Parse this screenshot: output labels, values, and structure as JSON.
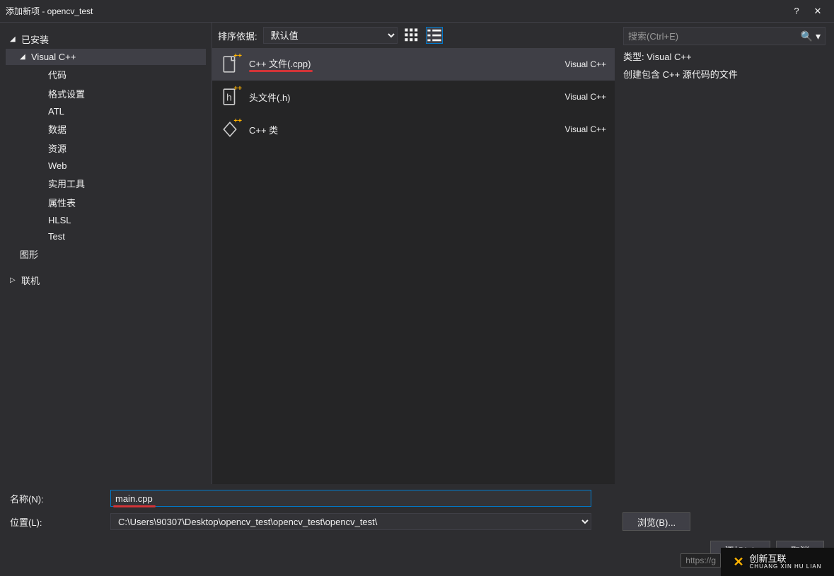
{
  "window": {
    "title": "添加新项 - opencv_test",
    "help": "?",
    "close": "✕"
  },
  "sidebar": {
    "installed": "已安装",
    "vcpp": "Visual C++",
    "items": [
      "代码",
      "格式设置",
      "ATL",
      "数据",
      "资源",
      "Web",
      "实用工具",
      "属性表",
      "HLSL",
      "Test"
    ],
    "graphics": "图形",
    "online": "联机"
  },
  "toolbar": {
    "sortlabel": "排序依据:",
    "sortvalue": "默认值"
  },
  "templates": [
    {
      "name": "C++ 文件(.cpp)",
      "lang": "Visual C++",
      "selected": true
    },
    {
      "name": "头文件(.h)",
      "lang": "Visual C++",
      "selected": false
    },
    {
      "name": "C++ 类",
      "lang": "Visual C++",
      "selected": false
    }
  ],
  "right": {
    "placeholder": "搜索(Ctrl+E)",
    "typelabel": "类型:",
    "typeval": "Visual C++",
    "desc": "创建包含 C++ 源代码的文件"
  },
  "form": {
    "namelabel": "名称(N):",
    "nameval": "main.cpp",
    "loclabel": "位置(L):",
    "locval": "C:\\Users\\90307\\Desktop\\opencv_test\\opencv_test\\opencv_test\\",
    "browse": "浏览(B)...",
    "add": "添加(A)",
    "cancel": "取消"
  },
  "watermark": {
    "https": "https://g",
    "brand": "创新互联",
    "sub": "CHUANG XIN HU LIAN"
  }
}
